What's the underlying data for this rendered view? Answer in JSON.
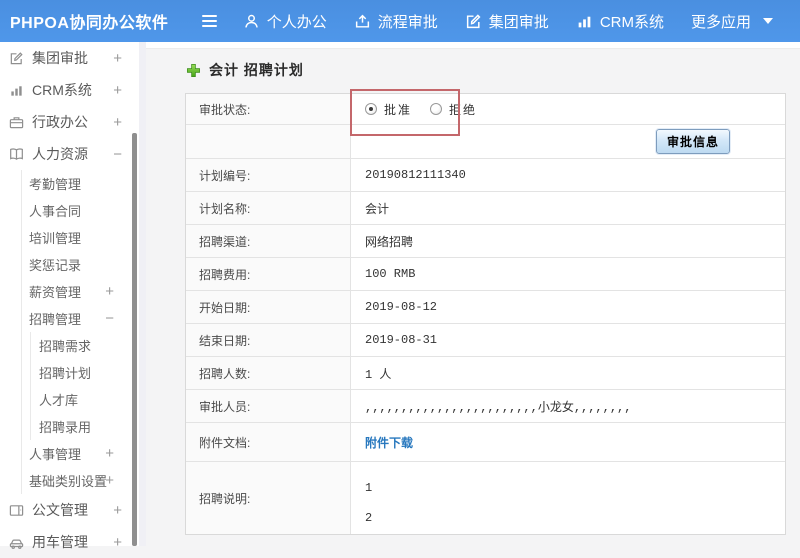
{
  "colors": {
    "topbar_blue": "#4b92e4",
    "annotation_red": "#c4676b",
    "link_blue": "#2878be",
    "plus_green": "#55ad2b"
  },
  "topbar": {
    "logo": "PHPOA协同办公软件",
    "menu": [
      {
        "label": "个人办公",
        "icon": "user-icon"
      },
      {
        "label": "流程审批",
        "icon": "flow-icon"
      },
      {
        "label": "集团审批",
        "icon": "edit-icon"
      },
      {
        "label": "CRM系统",
        "icon": "chart-icon"
      },
      {
        "label": "更多应用",
        "icon": "caret-down-icon"
      }
    ]
  },
  "sidebar": {
    "items": [
      {
        "label": "集团审批",
        "icon": "edit-square-icon",
        "expand": "+",
        "level": 0
      },
      {
        "label": "CRM系统",
        "icon": "bar-chart-icon",
        "expand": "+",
        "level": 0
      },
      {
        "label": "行政办公",
        "icon": "briefcase-icon",
        "expand": "+",
        "level": 0
      },
      {
        "label": "人力资源",
        "icon": "book-icon",
        "expand": "−",
        "level": 0
      },
      {
        "label": "考勤管理",
        "level": 1
      },
      {
        "label": "人事合同",
        "level": 1
      },
      {
        "label": "培训管理",
        "level": 1
      },
      {
        "label": "奖惩记录",
        "level": 1
      },
      {
        "label": "薪资管理",
        "expand": "+",
        "level": 1
      },
      {
        "label": "招聘管理",
        "expand": "−",
        "level": 1
      },
      {
        "label": "招聘需求",
        "level": 2
      },
      {
        "label": "招聘计划",
        "level": 2
      },
      {
        "label": "人才库",
        "level": 2
      },
      {
        "label": "招聘录用",
        "level": 2
      },
      {
        "label": "人事管理",
        "expand": "+",
        "level": 1
      },
      {
        "label": "基础类别设置",
        "expand": "+",
        "level": 1
      },
      {
        "label": "公文管理",
        "icon": "document-icon",
        "expand": "+",
        "level": 0
      },
      {
        "label": "用车管理",
        "icon": "car-icon",
        "expand": "+",
        "level": 0
      }
    ]
  },
  "main": {
    "title": "会计 招聘计划",
    "status_row": {
      "label": "审批状态:",
      "options": [
        {
          "label": "批准",
          "selected": true
        },
        {
          "label": "拒绝",
          "selected": false
        }
      ]
    },
    "approve_info_button": "审批信息",
    "rows": [
      {
        "label": "计划编号:",
        "value": "20190812111340"
      },
      {
        "label": "计划名称:",
        "value": "会计"
      },
      {
        "label": "招聘渠道:",
        "value": "网络招聘"
      },
      {
        "label": "招聘费用:",
        "value": "100 RMB"
      },
      {
        "label": "开始日期:",
        "value": "2019-08-12"
      },
      {
        "label": "结束日期:",
        "value": "2019-08-31"
      },
      {
        "label": "招聘人数:",
        "value": "1 人"
      },
      {
        "label": "审批人员:",
        "value": ",,,,,,,,,,,,,,,,,,,,,,,,小龙女,,,,,,,,"
      }
    ],
    "attachment_row": {
      "label": "附件文档:",
      "link_text": "附件下载"
    },
    "description_row": {
      "label": "招聘说明:",
      "value": "1\n2"
    }
  }
}
